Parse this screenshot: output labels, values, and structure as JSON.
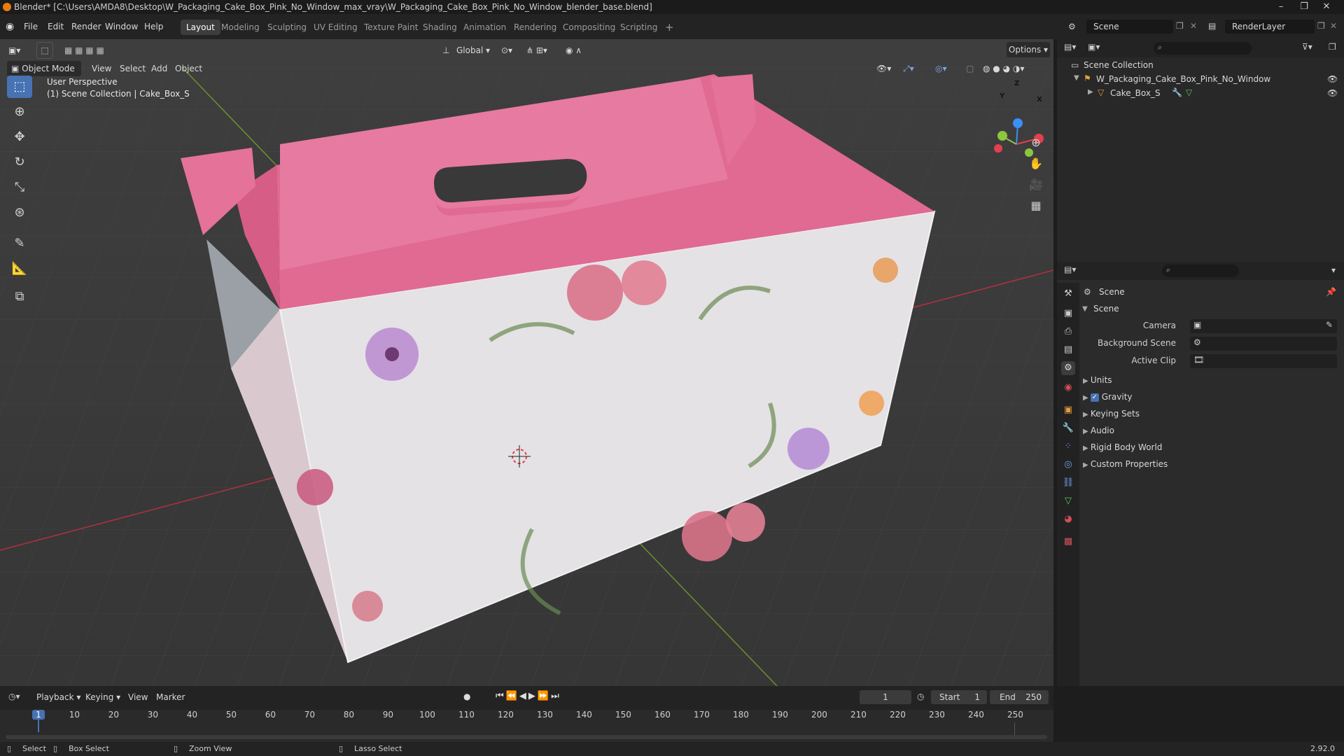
{
  "window": {
    "title": "Blender* [C:\\Users\\AMDA8\\Desktop\\W_Packaging_Cake_Box_Pink_No_Window_max_vray\\W_Packaging_Cake_Box_Pink_No_Window_blender_base.blend]"
  },
  "menu": [
    "File",
    "Edit",
    "Render",
    "Window",
    "Help"
  ],
  "workspaces": [
    {
      "label": "Layout",
      "active": true
    },
    {
      "label": "Modeling"
    },
    {
      "label": "Sculpting"
    },
    {
      "label": "UV Editing"
    },
    {
      "label": "Texture Paint"
    },
    {
      "label": "Shading"
    },
    {
      "label": "Animation"
    },
    {
      "label": "Rendering"
    },
    {
      "label": "Compositing"
    },
    {
      "label": "Scripting"
    }
  ],
  "scene_field": "Scene",
  "renderlayer_field": "RenderLayer",
  "viewport": {
    "transform_orientation": "Global",
    "options_label": "Options",
    "mode": "Object Mode",
    "header_menus": [
      "View",
      "Select",
      "Add",
      "Object"
    ],
    "overlay_line1": "User Perspective",
    "overlay_line2": "(1) Scene Collection | Cake_Box_S",
    "gizmo_axes": [
      "Z",
      "Y",
      "X"
    ]
  },
  "outliner": {
    "root": "Scene Collection",
    "items": [
      {
        "label": "W_Packaging_Cake_Box_Pink_No_Window"
      },
      {
        "label": "Cake_Box_S"
      }
    ]
  },
  "properties": {
    "context": "Scene",
    "panel_title": "Scene",
    "fields": [
      {
        "label": "Camera"
      },
      {
        "label": "Background Scene"
      },
      {
        "label": "Active Clip"
      }
    ],
    "subpanels": [
      {
        "label": "Units"
      },
      {
        "label": "Gravity",
        "checked": true
      },
      {
        "label": "Keying Sets"
      },
      {
        "label": "Audio"
      },
      {
        "label": "Rigid Body World"
      },
      {
        "label": "Custom Properties"
      }
    ]
  },
  "timeline": {
    "menus": [
      "Playback",
      "Keying",
      "View",
      "Marker"
    ],
    "current_frame": "1",
    "start_label": "Start",
    "start_value": "1",
    "end_label": "End",
    "end_value": "250",
    "ruler": [
      "1",
      "10",
      "20",
      "30",
      "40",
      "50",
      "60",
      "70",
      "80",
      "90",
      "100",
      "110",
      "120",
      "130",
      "140",
      "150",
      "160",
      "170",
      "180",
      "190",
      "200",
      "210",
      "220",
      "230",
      "240",
      "250"
    ]
  },
  "statusbar": {
    "select": "Select",
    "box_select": "Box Select",
    "zoom_view": "Zoom View",
    "lasso_select": "Lasso Select",
    "version": "2.92.0"
  },
  "colors": {
    "accent": "#4772b3",
    "box_pink": "#e06a91",
    "box_grey": "#8b8f94",
    "axis_x": "#e0404f",
    "axis_y": "#8cc63f",
    "axis_z": "#3b8ff5"
  }
}
